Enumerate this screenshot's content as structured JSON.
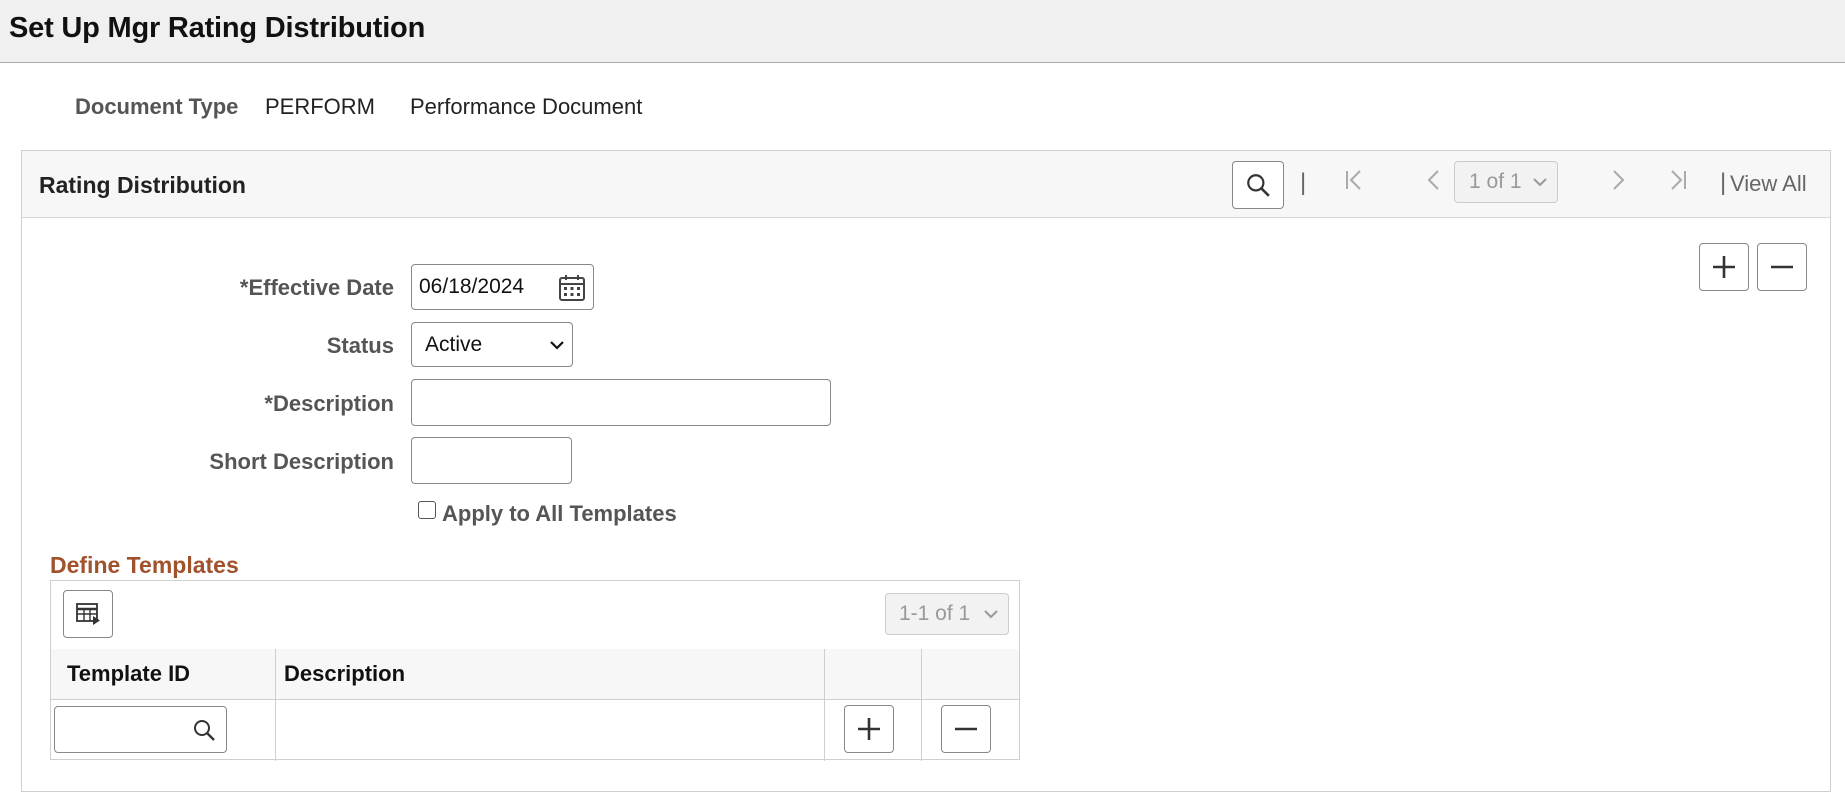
{
  "page": {
    "title": "Set Up Mgr Rating Distribution"
  },
  "document": {
    "label": "Document Type",
    "code": "PERFORM",
    "description": "Performance Document"
  },
  "panel": {
    "title": "Rating Distribution",
    "nav": {
      "page_indicator": "1 of 1",
      "view_all": "View All"
    }
  },
  "form": {
    "effective_date_label": "*Effective Date",
    "effective_date_value": "06/18/2024",
    "status_label": "Status",
    "status_value": "Active",
    "description_label": "*Description",
    "description_value": "",
    "short_description_label": "Short Description",
    "short_description_value": "",
    "apply_all_label": "Apply to All Templates",
    "apply_all_checked": false
  },
  "templates": {
    "section_title": "Define Templates",
    "page_indicator": "1-1 of 1",
    "columns": [
      "Template ID",
      "Description"
    ],
    "rows": [
      {
        "template_id": "",
        "description": ""
      }
    ]
  },
  "icons": {
    "search": "search-icon",
    "first": "first-page-icon",
    "prev": "previous-page-icon",
    "next": "next-page-icon",
    "last": "last-page-icon",
    "calendar": "calendar-icon",
    "add": "plus-icon",
    "remove": "minus-icon",
    "grid_personalize": "grid-personalize-icon"
  }
}
